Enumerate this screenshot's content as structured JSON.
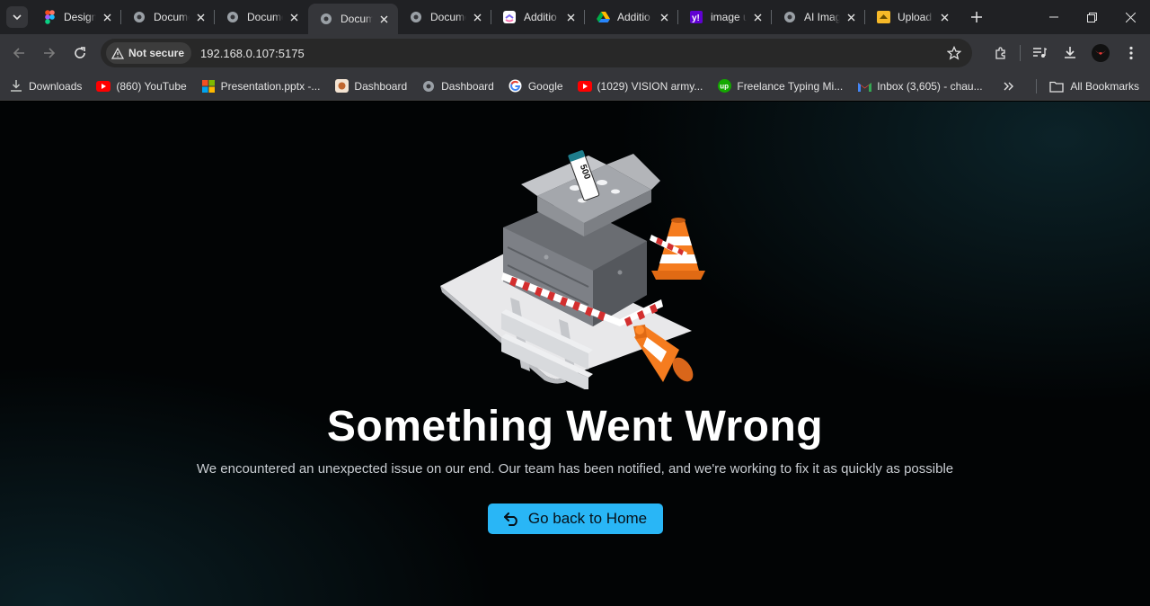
{
  "tabs": [
    {
      "title": "Design",
      "favicon": "figma-icon",
      "active": false
    },
    {
      "title": "Docume",
      "favicon": "globe-icon",
      "active": false
    },
    {
      "title": "Docume",
      "favicon": "globe-icon",
      "active": false
    },
    {
      "title": "Docume",
      "favicon": "globe-icon",
      "active": true
    },
    {
      "title": "Docume",
      "favicon": "globe-icon",
      "active": false
    },
    {
      "title": "Additio",
      "favicon": "clickup-icon",
      "active": false
    },
    {
      "title": "Additio",
      "favicon": "google-drive-icon",
      "active": false
    },
    {
      "title": "image u",
      "favicon": "yahoo-icon",
      "active": false
    },
    {
      "title": "AI Imag",
      "favicon": "globe-icon",
      "active": false
    },
    {
      "title": "Upload",
      "favicon": "upload-app-icon",
      "active": false
    }
  ],
  "omnibox": {
    "security_label": "Not secure",
    "url": "192.168.0.107:5175"
  },
  "bookmarks": [
    {
      "label": "Downloads",
      "icon": "download-icon"
    },
    {
      "label": "(860) YouTube",
      "icon": "youtube-icon"
    },
    {
      "label": "Presentation.pptx -...",
      "icon": "microsoft-icon"
    },
    {
      "label": "Dashboard",
      "icon": "app-icon"
    },
    {
      "label": "Dashboard",
      "icon": "globe-icon"
    },
    {
      "label": "Google",
      "icon": "google-icon"
    },
    {
      "label": "(1029) VISION army...",
      "icon": "youtube-icon"
    },
    {
      "label": "Freelance Typing Mi...",
      "icon": "upwork-icon"
    },
    {
      "label": "Inbox (3,605) - chau...",
      "icon": "gmail-icon"
    }
  ],
  "all_bookmarks_label": "All Bookmarks",
  "illustration": {
    "tag_text": "500"
  },
  "page": {
    "heading": "Something Went Wrong",
    "message": "We encountered an unexpected issue on our end. Our team has been notified, and we're working to fix it as quickly as possible",
    "home_button_label": "Go back to Home",
    "accent_color": "#29b6f6"
  }
}
